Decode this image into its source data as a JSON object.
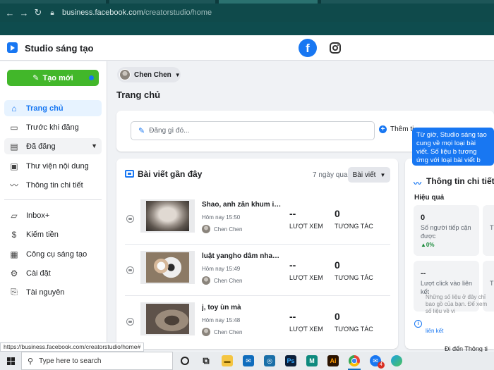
{
  "browser": {
    "url_host": "business.facebook.com",
    "url_path": "/creatorstudio/home",
    "status_url": "https://business.facebook.com/creatorstudio/home#"
  },
  "app": {
    "title": "Studio sáng tạo",
    "facebook_tab_icon": "facebook-icon",
    "instagram_tab_icon": "instagram-icon"
  },
  "sidebar": {
    "create_label": "Tạo mới",
    "items": [
      {
        "label": "Trang chủ",
        "icon": "home-icon",
        "active": true
      },
      {
        "label": "Trước khi đăng",
        "icon": "document-icon"
      },
      {
        "label": "Đã đăng",
        "icon": "published-icon"
      },
      {
        "label": "Thư viện nội dung",
        "icon": "library-icon"
      },
      {
        "label": "Thông tin chi tiết",
        "icon": "insights-icon"
      },
      {
        "label": "Inbox+",
        "icon": "inbox-icon"
      },
      {
        "label": "Kiếm tiền",
        "icon": "dollar-icon"
      },
      {
        "label": "Công cụ sáng tạo",
        "icon": "tools-icon"
      },
      {
        "label": "Cài đặt",
        "icon": "gear-icon"
      },
      {
        "label": "Tài nguyên",
        "icon": "resources-icon"
      }
    ]
  },
  "main": {
    "page_selector": "Chen Chen",
    "page_title": "Trang chủ",
    "composer_placeholder": "Đăng gì đó...",
    "add_story_label": "Thêm ti",
    "tooltip": "Từ giờ, Studio sáng tạo cung về mọi loại bài viết. Số liệu b tương ứng với loại bài viết b xem."
  },
  "posts": {
    "title": "Bài viết gần đây",
    "range": "7 ngày qua",
    "filter": "Bài viết",
    "items": [
      {
        "title": "Shao, anh zẫn khum iu toy ...",
        "time": "Hôm nay 15:50",
        "author": "Chen Chen",
        "views": "--",
        "views_label": "LƯỢT XEM",
        "interactions": "0",
        "interactions_label": "TƯƠNG TÁC"
      },
      {
        "title": "luật yangho dâm nhau bản...",
        "time": "Hôm nay 15:49",
        "author": "Chen Chen",
        "views": "--",
        "views_label": "LƯỢT XEM",
        "interactions": "0",
        "interactions_label": "TƯƠNG TÁC"
      },
      {
        "title": "j, toy ùn mà",
        "time": "Hôm nay 15:48",
        "author": "Chen Chen",
        "views": "--",
        "views_label": "LƯỢT XEM",
        "interactions": "0",
        "interactions_label": "TƯƠNG TÁC"
      }
    ]
  },
  "insights": {
    "title": "Thông tin chi tiết",
    "subtitle": "Hiệu quả",
    "stats": [
      {
        "value": "0",
        "label": "Số người tiếp cận được",
        "change": "0%"
      },
      {
        "value": "",
        "label": "Tì",
        "change": ""
      },
      {
        "value": "--",
        "label": "Lượt click vào liên kết",
        "change": ""
      },
      {
        "value": "",
        "label": "T",
        "change": ""
      }
    ],
    "note": "Những số liệu ở đây chỉ bao gồ của bạn. Để xem số liệu về vi",
    "note_link": "liên kết",
    "goto": "Đi đến Thông ti"
  },
  "taskbar": {
    "search_placeholder": "Type here to search",
    "mail_badge": "4"
  }
}
